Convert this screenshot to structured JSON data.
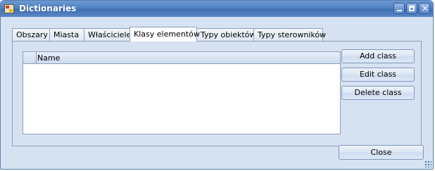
{
  "window": {
    "title": "Dictionaries",
    "icon": "app-icon",
    "controls": [
      "minimize-icon",
      "maximize-icon",
      "close-icon"
    ]
  },
  "tabs": [
    {
      "label": "Obszary",
      "active": false
    },
    {
      "label": "Miasta",
      "active": false
    },
    {
      "label": "Właściciele",
      "active": false
    },
    {
      "label": "Klasy elementów",
      "active": true
    },
    {
      "label": "Typy obiektów",
      "active": false
    },
    {
      "label": "Typy sterowników",
      "active": false
    }
  ],
  "grid": {
    "columns": [
      "Name"
    ],
    "rows": []
  },
  "buttons": {
    "add": "Add class",
    "edit": "Edit class",
    "delete": "Delete class",
    "close": "Close"
  },
  "colors": {
    "titlebar": "#4f80c0",
    "client_bg": "#d6e2f2",
    "border": "#8ba0bc"
  }
}
